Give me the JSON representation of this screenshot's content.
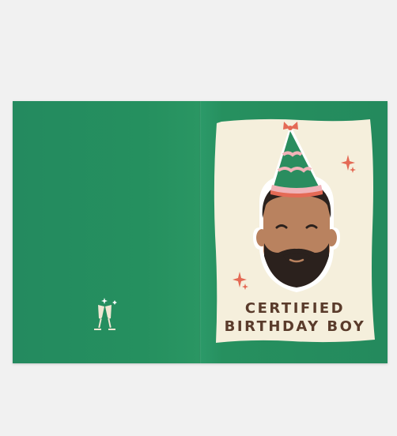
{
  "card": {
    "line1": "CERTIFIED",
    "line2": "BIRTHDAY BOY"
  },
  "colors": {
    "background": "#f1f1f1",
    "card_green": "#24895e",
    "panel_cream": "#f5efdc",
    "title_brown": "#5a3b2b",
    "accent_red": "#e46a55",
    "hat_pink": "#f0b3b8",
    "skin": "#b9825f"
  },
  "icons": [
    "party-hat-icon",
    "sparkle-icon",
    "champagne-glasses-icon"
  ]
}
